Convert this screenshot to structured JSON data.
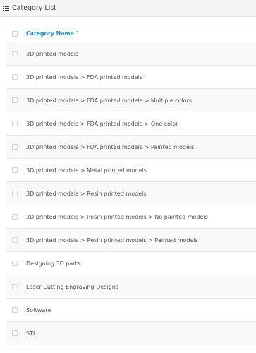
{
  "panel": {
    "title": "Category List",
    "icon": "list-icon"
  },
  "table": {
    "header": {
      "column_label": "Category Name",
      "sort_indicator": "^"
    },
    "rows": [
      "3D printed models",
      "3D printed models  >  FDA printed models",
      "3D printed models  >  FDA printed models  >  Multiple colors",
      "3D printed models  >  FDA printed models  >  One color",
      "3D printed models  >  FDA printed models  >  Painted models",
      "3D printed models  >  Metal printed models",
      "3D printed models  >  Resin printed models",
      "3D printed models  >  Resin printed models  >  No painted models",
      "3D printed models  >  Resin printed models  >  Painted models",
      "Designing 3D parts",
      "Laser Cutting Engraving Designs",
      "Software",
      "STL"
    ]
  },
  "colors": {
    "header_link": "#1e91cf",
    "heading_bg": "#f5f5f5",
    "stripe": "#f9f9f9"
  }
}
